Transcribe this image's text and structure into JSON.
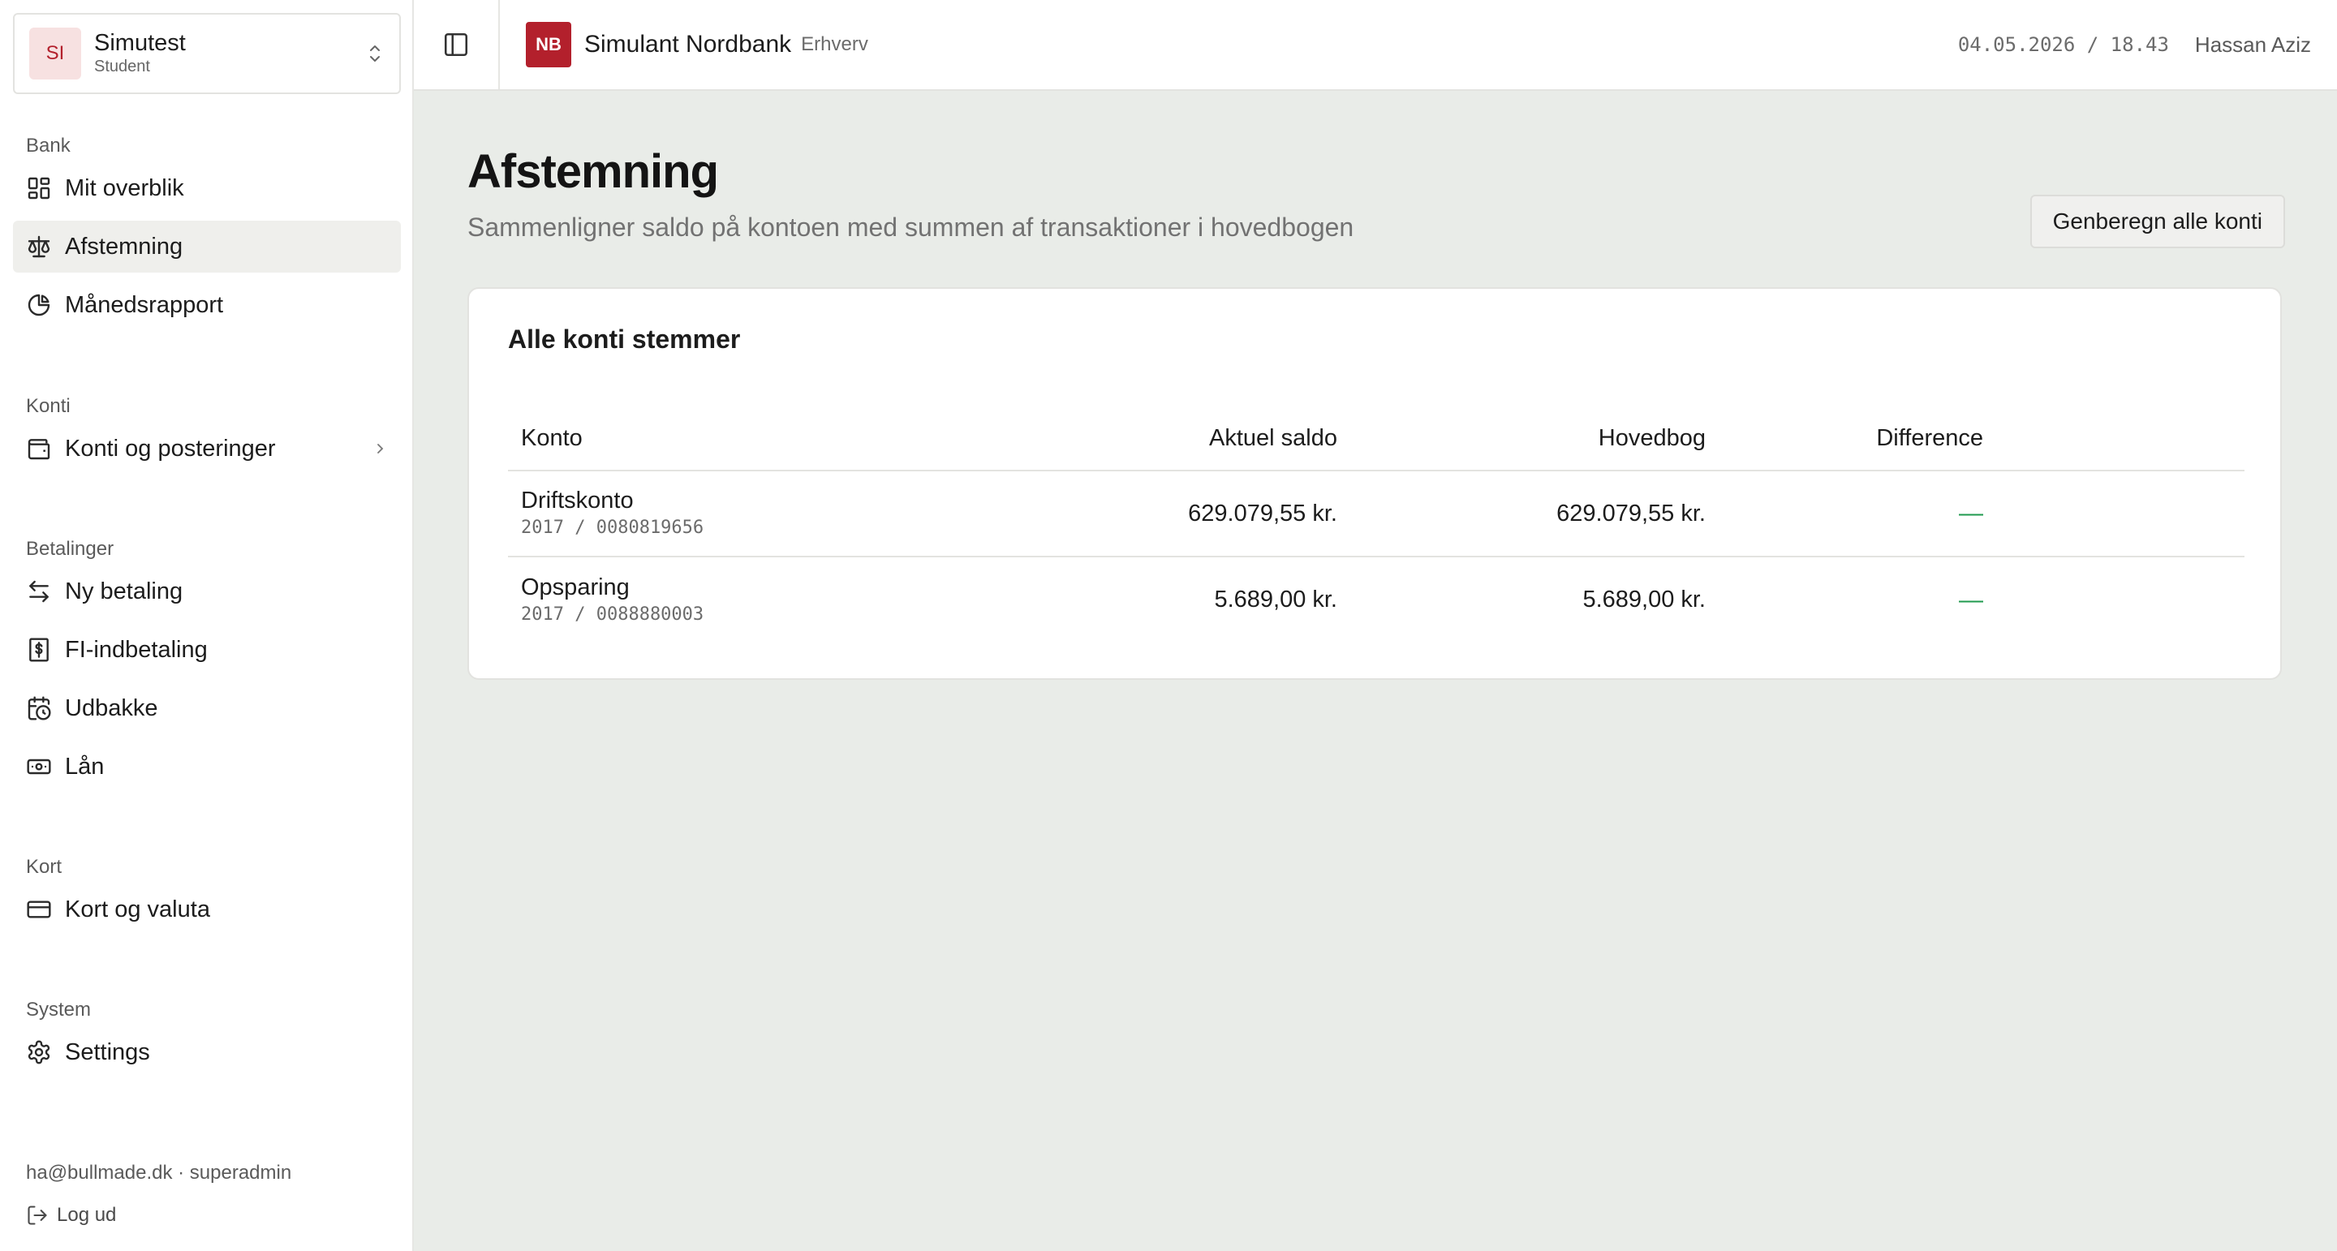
{
  "org": {
    "initials": "SI",
    "name": "Simutest",
    "role": "Student"
  },
  "nav": {
    "sections": [
      {
        "heading": "Bank",
        "items": [
          {
            "label": "Mit overblik",
            "icon": "dashboard-icon"
          },
          {
            "label": "Afstemning",
            "icon": "scale-icon",
            "active": true
          },
          {
            "label": "Månedsrapport",
            "icon": "pie-chart-icon"
          }
        ]
      },
      {
        "heading": "Konti",
        "items": [
          {
            "label": "Konti og posteringer",
            "icon": "wallet-icon",
            "has_children": true
          }
        ]
      },
      {
        "heading": "Betalinger",
        "items": [
          {
            "label": "Ny betaling",
            "icon": "transfer-icon"
          },
          {
            "label": "FI-indbetaling",
            "icon": "dollar-receipt-icon"
          },
          {
            "label": "Udbakke",
            "icon": "calendar-clock-icon"
          },
          {
            "label": "Lån",
            "icon": "banknote-icon"
          }
        ]
      },
      {
        "heading": "Kort",
        "items": [
          {
            "label": "Kort og valuta",
            "icon": "credit-card-icon"
          }
        ]
      },
      {
        "heading": "System",
        "items": [
          {
            "label": "Settings",
            "icon": "gear-icon"
          }
        ]
      }
    ]
  },
  "footer": {
    "user_line": "ha@bullmade.dk · superadmin",
    "logout": "Log ud"
  },
  "topbar": {
    "bank_initials": "NB",
    "bank_name": "Simulant Nordbank",
    "bank_tag": "Erhverv",
    "datetime": "04.05.2026 / 18.43",
    "user": "Hassan Aziz"
  },
  "page": {
    "title": "Afstemning",
    "subtitle": "Sammenligner saldo på kontoen med summen af transaktioner i hovedbogen",
    "recalc_button": "Genberegn alle konti"
  },
  "card": {
    "title": "Alle konti stemmer",
    "columns": {
      "konto": "Konto",
      "saldo": "Aktuel saldo",
      "hovedbog": "Hovedbog",
      "difference": "Difference"
    },
    "rows": [
      {
        "name": "Driftskonto",
        "number": "2017 / 0080819656",
        "saldo": "629.079,55 kr.",
        "hovedbog": "629.079,55 kr.",
        "difference": "—"
      },
      {
        "name": "Opsparing",
        "number": "2017 / 0088880003",
        "saldo": "5.689,00 kr.",
        "hovedbog": "5.689,00 kr.",
        "difference": "—"
      }
    ]
  },
  "colors": {
    "brand": "#b3202c",
    "ok": "#1f9a4e",
    "background": "#e9ece8"
  }
}
